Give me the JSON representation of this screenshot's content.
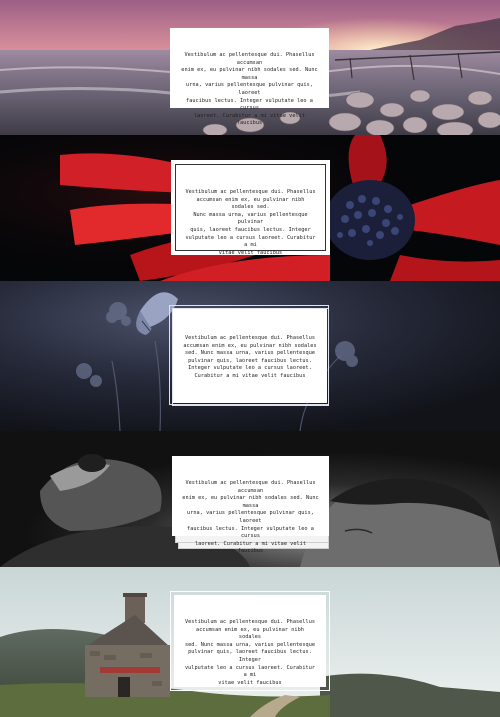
{
  "bands": [
    {
      "scene": "rocky-beach-sunset",
      "card_style": "plain",
      "lines": [
        "Vestibulum ac pellentesque dui. Phasellus accumsan",
        "enim ex, eu pulvinar nibh sodales sed. Nunc massa",
        "urna, varius pellentesque pulvinar quis, laoreet",
        "faucibus lectus. Integer vulputate leo a cursus",
        "laoreet. Curabitur a mi vitae velit faucibus"
      ]
    },
    {
      "scene": "red-flower-macro",
      "card_style": "inner-frame",
      "lines": [
        "Vestibulum ac pellentesque dui. Phasellus",
        "accumsan enim ex, eu pulvinar nibh sodales sed.",
        "Nunc massa urna, varius pellentesque pulvinar",
        "quis, laoreet faucibus lectus. Integer",
        "vulputate leo a cursus laoreet. Curabitur a mi",
        "vitae velit faucibus"
      ]
    },
    {
      "scene": "butterfly-night",
      "card_style": "double-outline",
      "lines": [
        "Vestibulum ac pellentesque dui. Phasellus",
        "accumsan enim ex, eu pulvinar nibh sodales",
        "sed. Nunc massa urna, varius pellentesque",
        "pulvinar quis, laoreet faucibus lectus.",
        "Integer vulputate leo a cursus laoreet.",
        "Curabitur a mi vitae velit faucibus"
      ]
    },
    {
      "scene": "dog-and-child-monochrome",
      "card_style": "stacked",
      "lines": [
        "Vestibulum ac pellentesque dui. Phasellus accumsan",
        "enim ex, eu pulvinar nibh sodales sed. Nunc massa",
        "urna, varius pellentesque pulvinar quis, laoreet",
        "faucibus lectus. Integer vulputate leo a cursus",
        "laoreet. Curabitur a mi vitae velit faucibus"
      ]
    },
    {
      "scene": "stone-cottage-highlands",
      "card_style": "outer-frame",
      "lines": [
        "Vestibulum ac pellentesque dui. Phasellus",
        "accumsan enim ex, eu pulvinar nibh sodales",
        "sed. Nunc massa urna, varius pellentesque",
        "pulvinar quis, laoreet faucibus lectus. Integer",
        "vulputate leo a cursus laoreet. Curabitur a mi",
        "vitae velit faucibus"
      ]
    }
  ]
}
